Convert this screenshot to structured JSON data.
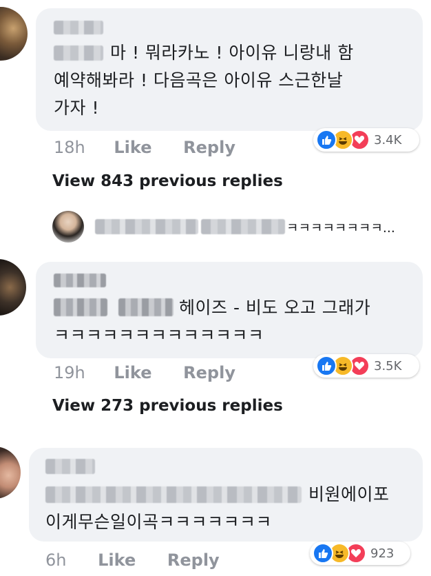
{
  "comments": [
    {
      "line1": "마 ! 뭐라카노 ! 아이유 니랑내 함",
      "line2": "예약해봐라 ! 다음곡은 아이유 스근한날",
      "line3": "가자 !",
      "time": "18h",
      "like_label": "Like",
      "reply_label": "Reply",
      "reaction_count": "3.4K",
      "view_replies": "View 843 previous replies"
    },
    {
      "line1": "헤이즈 - 비도 오고 그래가",
      "line2": "ㅋㅋㅋㅋㅋㅋㅋㅋㅋㅋㅋㅋㅋ",
      "time": "19h",
      "like_label": "Like",
      "reply_label": "Reply",
      "reaction_count": "3.5K",
      "view_replies": "View 273 previous replies"
    },
    {
      "line1": "비원에이포",
      "line2": "이게무슨일이곡ㅋㅋㅋㅋㅋㅋㅋ",
      "time": "6h",
      "like_label": "Like",
      "reply_label": "Reply",
      "reaction_count": "923"
    }
  ],
  "reply_preview": {
    "text": "ㅋㅋㅋㅋㅋㅋㅋㅋ..."
  },
  "icons": {
    "like": "thumbs-up-icon",
    "haha": "laughing-face-icon",
    "love": "heart-icon"
  },
  "colors": {
    "like": "#1877f2",
    "haha": "#f7b928",
    "love": "#f33e58",
    "bubble": "#f0f2f5",
    "meta": "#90949c"
  }
}
